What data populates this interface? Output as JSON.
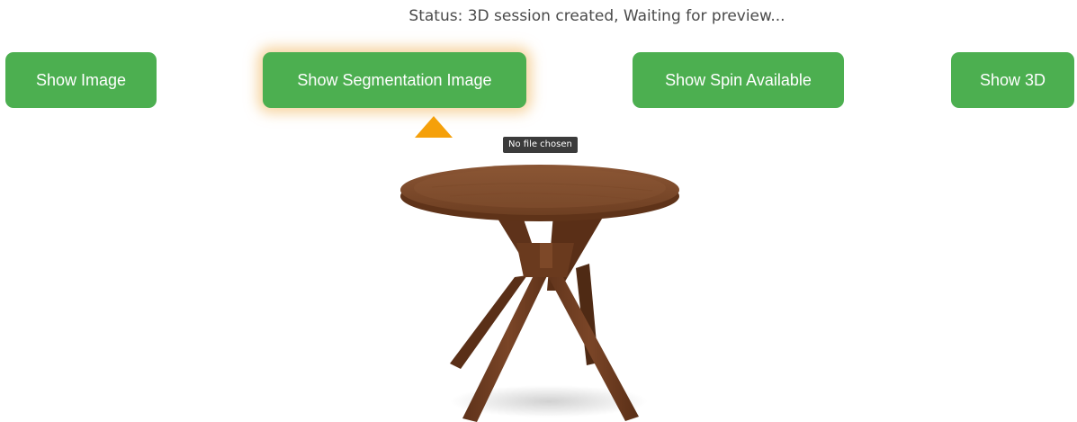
{
  "status": {
    "text": "Status: 3D session created, Waiting for preview..."
  },
  "buttons": {
    "show_image": "Show Image",
    "show_segmentation_image": "Show Segmentation Image",
    "show_spin_available": "Show Spin Available",
    "show_3d": "Show 3D"
  },
  "file_input": {
    "tooltip": "No file chosen"
  },
  "colors": {
    "button_green": "#4caf50",
    "active_glow": "#f0b45a",
    "indicator_orange": "#f5a00a",
    "tooltip_bg": "#3b3b3b",
    "status_text": "#4a4a4a"
  },
  "icons": {
    "selection_indicator": "triangle-up-icon"
  },
  "preview": {
    "subject": "round wooden dining table"
  }
}
